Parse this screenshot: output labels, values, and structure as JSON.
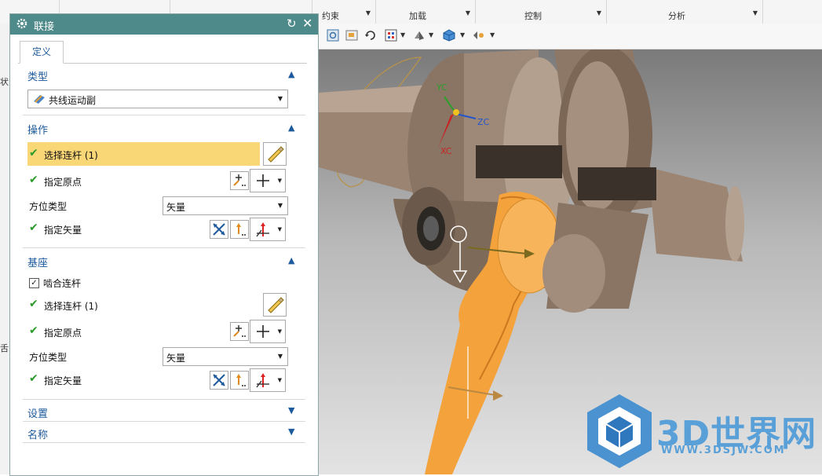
{
  "ribbon": {
    "groups": [
      {
        "label": "约束"
      },
      {
        "label": "加载"
      },
      {
        "label": "控制"
      },
      {
        "label": "分析"
      }
    ]
  },
  "left_strip": {
    "text_1": "状",
    "text_2": "舌"
  },
  "dialog": {
    "title": "联接",
    "tab_label": "定义",
    "sections": {
      "type": {
        "header": "类型",
        "selected": "共线运动副"
      },
      "operation": {
        "header": "操作",
        "select_link": "选择连杆 (1)",
        "specify_origin": "指定原点",
        "orientation_type_label": "方位类型",
        "orientation_type_value": "矢量",
        "specify_vector": "指定矢量"
      },
      "base": {
        "header": "基座",
        "mesh_link_label": "啮合连杆",
        "mesh_link_checked": true,
        "select_link": "选择连杆 (1)",
        "specify_origin": "指定原点",
        "orientation_type_label": "方位类型",
        "orientation_type_value": "矢量",
        "specify_vector": "指定矢量"
      },
      "settings": {
        "header": "设置"
      },
      "name": {
        "header": "名称"
      }
    }
  },
  "viewport": {
    "axis_labels": {
      "yc": "YC",
      "zc": "ZC",
      "xc": "XC"
    },
    "watermark": {
      "text": "3D世界网",
      "url": "WWW.3DSJW.COM"
    }
  },
  "colors": {
    "title_bar": "#4f8a8a",
    "highlight": "#f9d676",
    "accent": "#1d5a9c",
    "part_orange": "#f4a23c",
    "part_brown": "#8a7564"
  }
}
